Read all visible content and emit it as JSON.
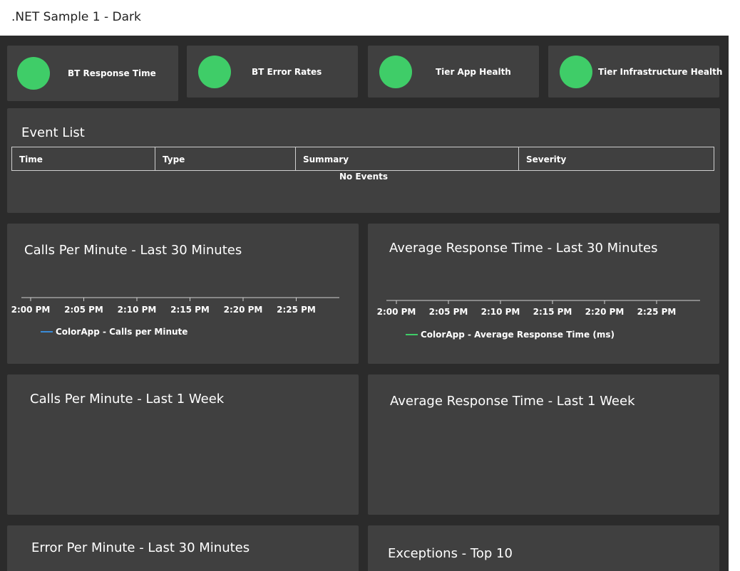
{
  "header": {
    "title": ".NET Sample 1 - Dark"
  },
  "colors": {
    "health_normal": "#3fcd68",
    "calls_series": "#3a8bd8",
    "response_series": "#3fcd68",
    "axis": "#cfcfcf"
  },
  "health_widgets": [
    {
      "label": "BT Response Time",
      "status": "normal"
    },
    {
      "label": "BT Error Rates",
      "status": "normal"
    },
    {
      "label": "Tier App Health",
      "status": "normal"
    },
    {
      "label": "Tier Infrastructure Health",
      "status": "normal"
    }
  ],
  "event_list": {
    "title": "Event List",
    "columns": [
      "Time",
      "Type",
      "Summary",
      "Severity"
    ],
    "empty_text": "No Events"
  },
  "widgets": {
    "calls_30": {
      "title": "Calls Per Minute - Last 30 Minutes"
    },
    "response_30": {
      "title": "Average Response Time - Last 30 Minutes"
    },
    "calls_week": {
      "title": "Calls Per Minute - Last 1 Week"
    },
    "response_week": {
      "title": "Average Response Time - Last 1 Week"
    },
    "errors_30": {
      "title": "Error Per Minute - Last 30 Minutes"
    },
    "exceptions": {
      "title": "Exceptions - Top 10"
    }
  },
  "chart_data": [
    {
      "type": "line",
      "title": "Calls Per Minute - Last 30 Minutes",
      "x_ticks": [
        "2:00 PM",
        "2:05 PM",
        "2:10 PM",
        "2:15 PM",
        "2:20 PM",
        "2:25 PM"
      ],
      "series": [
        {
          "name": "ColorApp - Calls per Minute",
          "values": []
        }
      ]
    },
    {
      "type": "line",
      "title": "Average Response Time - Last 30 Minutes",
      "x_ticks": [
        "2:00 PM",
        "2:05 PM",
        "2:10 PM",
        "2:15 PM",
        "2:20 PM",
        "2:25 PM"
      ],
      "series": [
        {
          "name": "ColorApp - Average Response Time (ms)",
          "values": []
        }
      ]
    }
  ]
}
